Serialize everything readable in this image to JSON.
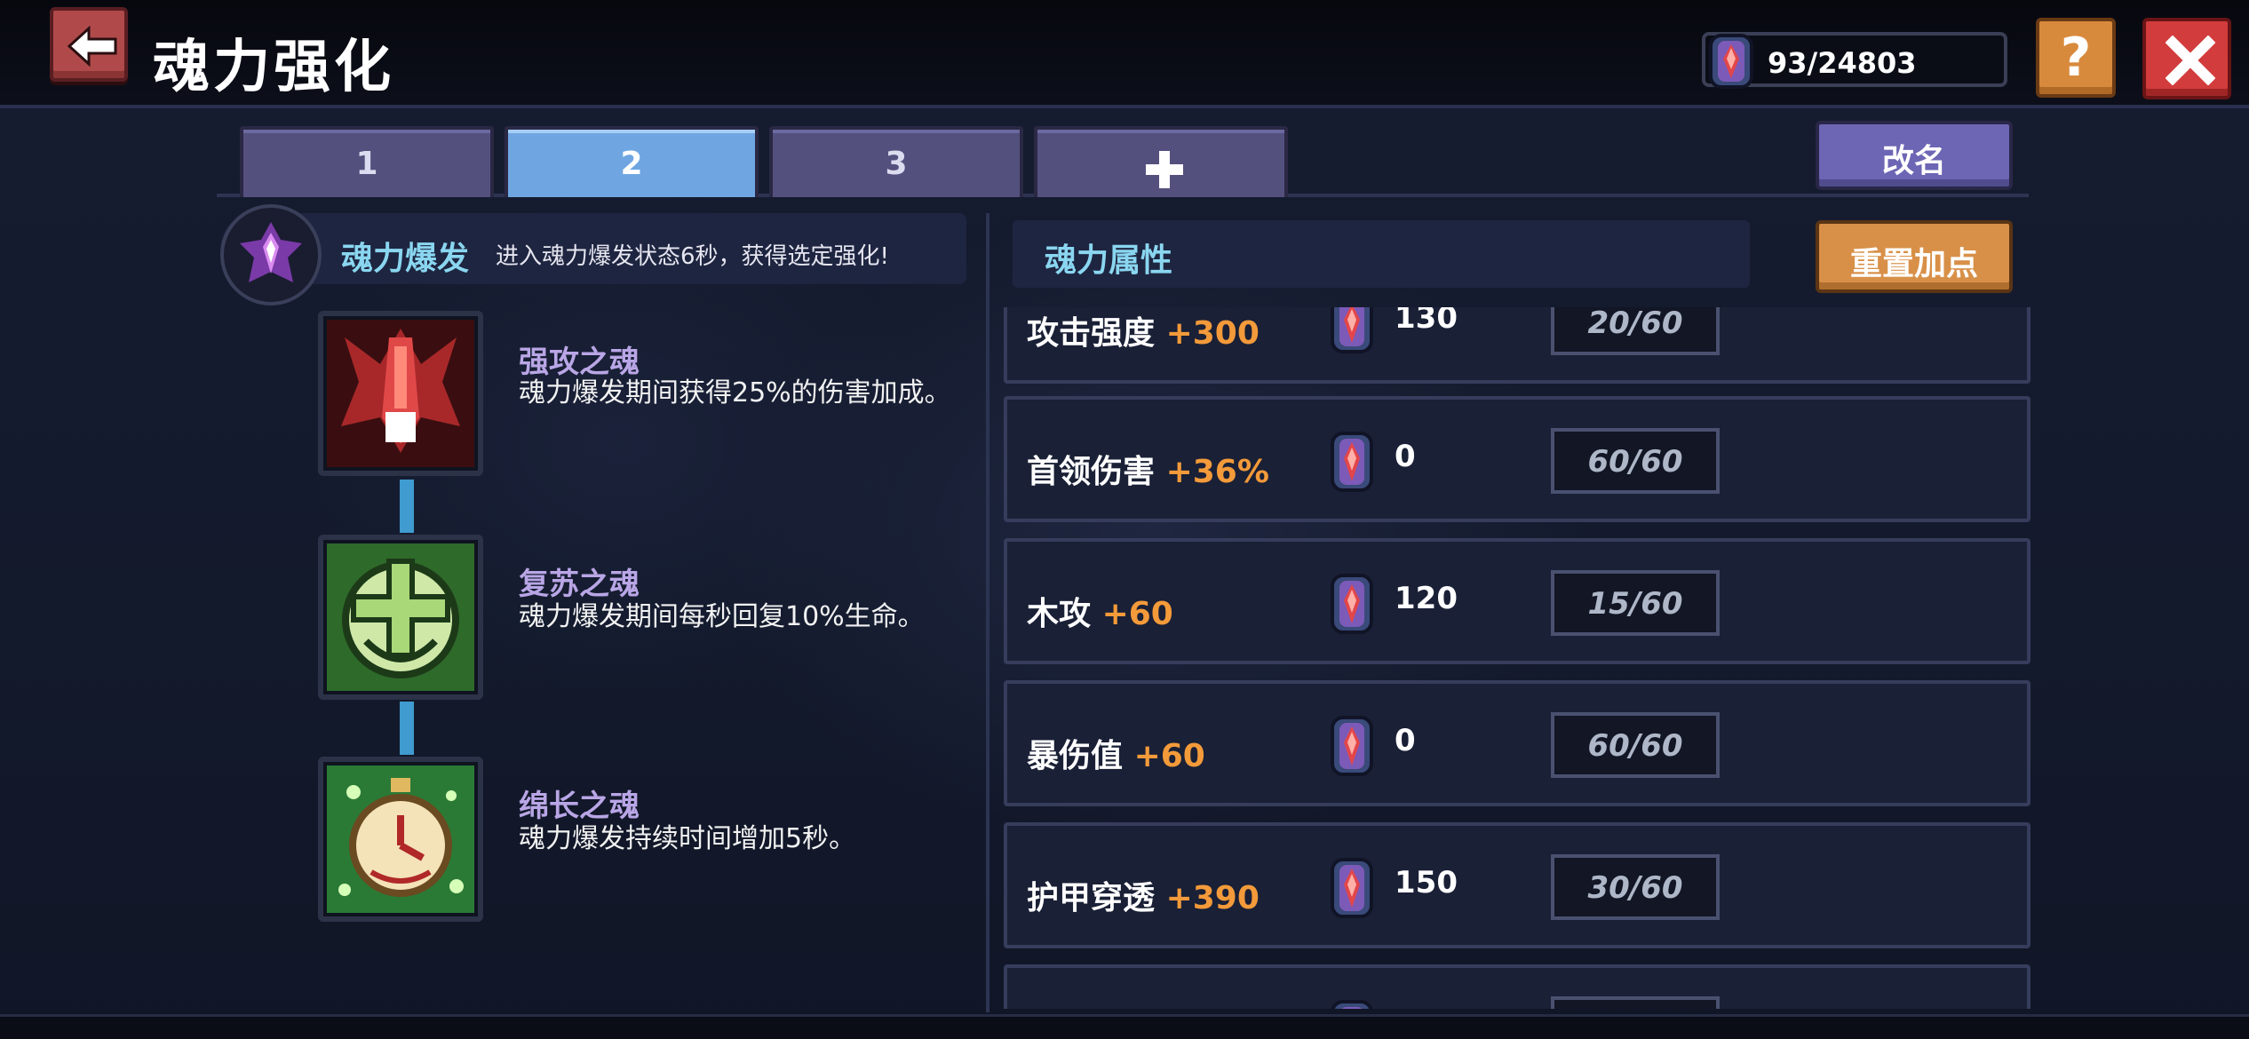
{
  "header": {
    "title": "魂力强化",
    "currency_value": "93/24803",
    "help_label": "?"
  },
  "tabs": [
    {
      "label": "1",
      "active": false
    },
    {
      "label": "2",
      "active": true
    },
    {
      "label": "3",
      "active": false
    },
    {
      "label": "",
      "icon": "plus-icon",
      "active": false
    }
  ],
  "buttons": {
    "rename": "改名",
    "reset": "重置加点"
  },
  "left_panel": {
    "title": "魂力爆发",
    "description": "进入魂力爆发状态6秒，获得选定强化!",
    "skills": [
      {
        "name": "强攻之魂",
        "desc": "魂力爆发期间获得25%的伤害加成。",
        "icon": "red-flame-icon"
      },
      {
        "name": "复苏之魂",
        "desc": "魂力爆发期间每秒回复10%生命。",
        "icon": "green-heal-icon"
      },
      {
        "name": "绵长之魂",
        "desc": "魂力爆发持续时间增加5秒。",
        "icon": "stopwatch-icon"
      }
    ]
  },
  "right_panel": {
    "title": "魂力属性",
    "stats": [
      {
        "name": "攻击强度",
        "bonus": "+300",
        "cost": "130",
        "level": "20/60"
      },
      {
        "name": "首领伤害",
        "bonus": "+36%",
        "cost": "0",
        "level": "60/60"
      },
      {
        "name": "木攻",
        "bonus": "+60",
        "cost": "120",
        "level": "15/60"
      },
      {
        "name": "暴伤值",
        "bonus": "+60",
        "cost": "0",
        "level": "60/60"
      },
      {
        "name": "护甲穿透",
        "bonus": "+390",
        "cost": "150",
        "level": "30/60"
      }
    ]
  },
  "colors": {
    "accent_cyan": "#8ad6f0",
    "bonus_orange": "#f39a3a",
    "skill_name_purple": "#b9a6e6",
    "tab_active": "#6fa6e2"
  }
}
